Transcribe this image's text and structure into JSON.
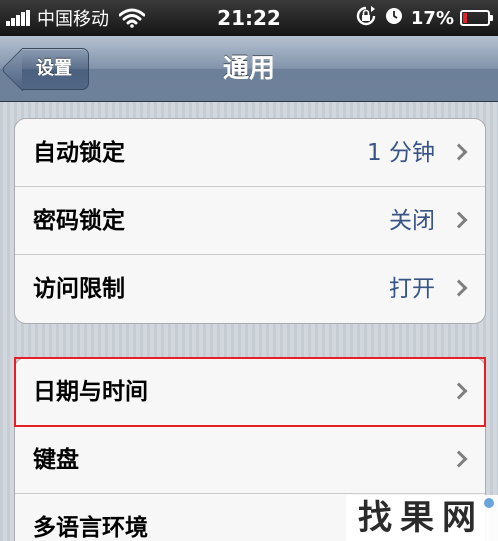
{
  "status_bar": {
    "carrier": "中国移动",
    "time": "21:22",
    "battery_percent": "17%",
    "battery_level": 0.17,
    "signal_icon": "signal-bars-icon",
    "wifi_icon": "wifi-icon",
    "rotation_lock_icon": "rotation-lock-icon",
    "alarm_icon": "clock-icon",
    "battery_color": "#e0232b"
  },
  "nav": {
    "back_label": "设置",
    "title": "通用"
  },
  "group1": {
    "rows": [
      {
        "label": "自动锁定",
        "value": "1 分钟"
      },
      {
        "label": "密码锁定",
        "value": "关闭"
      },
      {
        "label": "访问限制",
        "value": "打开"
      }
    ]
  },
  "group2": {
    "rows": [
      {
        "label": "日期与时间",
        "value": ""
      },
      {
        "label": "键盘",
        "value": ""
      },
      {
        "label": "多语言环境",
        "value": ""
      }
    ]
  },
  "colors": {
    "value_text": "#385487",
    "highlight": "#e41f26",
    "nav_bar": "#7486a0"
  },
  "watermark": {
    "text": "找果网"
  }
}
